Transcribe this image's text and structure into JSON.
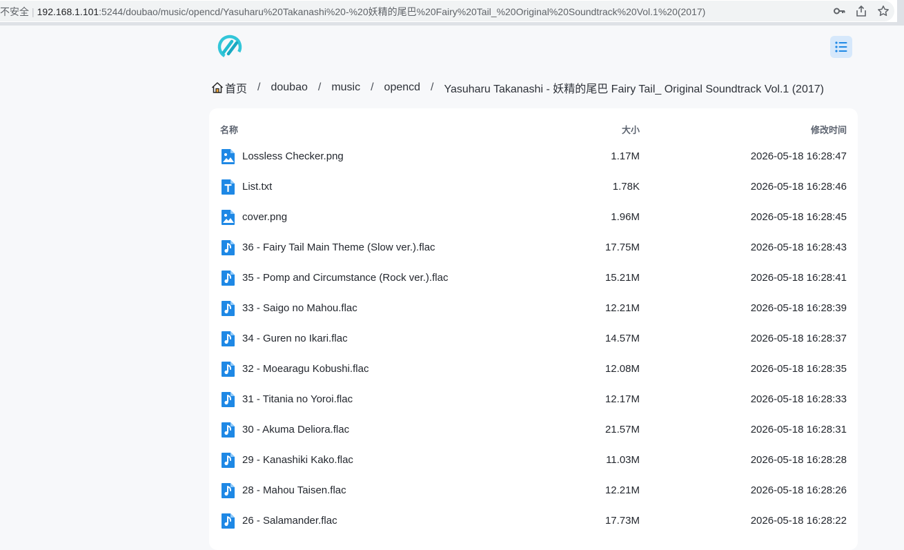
{
  "browser": {
    "security_label": "不安全",
    "url_host": "192.168.1.101",
    "url_path": ":5244/doubao/music/opencd/Yasuharu%20Takanashi%20-%20妖精的尾巴%20Fairy%20Tail_%20Original%20Soundtrack%20Vol.1%20(2017)",
    "icons": [
      "key-icon",
      "share-icon",
      "star-icon"
    ]
  },
  "header": {
    "logo": "app-logo",
    "menu_icon": "list-icon",
    "accent_color": "#1e88e5"
  },
  "breadcrumb": {
    "home_label": "首页",
    "items": [
      "doubao",
      "music",
      "opencd",
      "Yasuharu Takanashi - 妖精的尾巴 Fairy Tail_ Original Soundtrack Vol.1 (2017)"
    ],
    "separator": "/"
  },
  "table": {
    "columns": {
      "name": "名称",
      "size": "大小",
      "modified": "修改时间"
    },
    "rows": [
      {
        "icon": "image",
        "name": "Lossless Checker.png",
        "size": "1.17M",
        "modified": "2026-05-18 16:28:47"
      },
      {
        "icon": "text",
        "name": "List.txt",
        "size": "1.78K",
        "modified": "2026-05-18 16:28:46"
      },
      {
        "icon": "image",
        "name": "cover.png",
        "size": "1.96M",
        "modified": "2026-05-18 16:28:45"
      },
      {
        "icon": "audio",
        "name": "36 - Fairy Tail Main Theme (Slow ver.).flac",
        "size": "17.75M",
        "modified": "2026-05-18 16:28:43"
      },
      {
        "icon": "audio",
        "name": "35 - Pomp and Circumstance (Rock ver.).flac",
        "size": "15.21M",
        "modified": "2026-05-18 16:28:41"
      },
      {
        "icon": "audio",
        "name": "33 - Saigo no Mahou.flac",
        "size": "12.21M",
        "modified": "2026-05-18 16:28:39"
      },
      {
        "icon": "audio",
        "name": "34 - Guren no Ikari.flac",
        "size": "14.57M",
        "modified": "2026-05-18 16:28:37"
      },
      {
        "icon": "audio",
        "name": "32 - Moearagu Kobushi.flac",
        "size": "12.08M",
        "modified": "2026-05-18 16:28:35"
      },
      {
        "icon": "audio",
        "name": "31 - Titania no Yoroi.flac",
        "size": "12.17M",
        "modified": "2026-05-18 16:28:33"
      },
      {
        "icon": "audio",
        "name": "30 - Akuma Deliora.flac",
        "size": "21.57M",
        "modified": "2026-05-18 16:28:31"
      },
      {
        "icon": "audio",
        "name": "29 - Kanashiki Kako.flac",
        "size": "11.03M",
        "modified": "2026-05-18 16:28:28"
      },
      {
        "icon": "audio",
        "name": "28 - Mahou Taisen.flac",
        "size": "12.21M",
        "modified": "2026-05-18 16:28:26"
      },
      {
        "icon": "audio",
        "name": "26 - Salamander.flac",
        "size": "17.73M",
        "modified": "2026-05-18 16:28:22"
      }
    ]
  }
}
